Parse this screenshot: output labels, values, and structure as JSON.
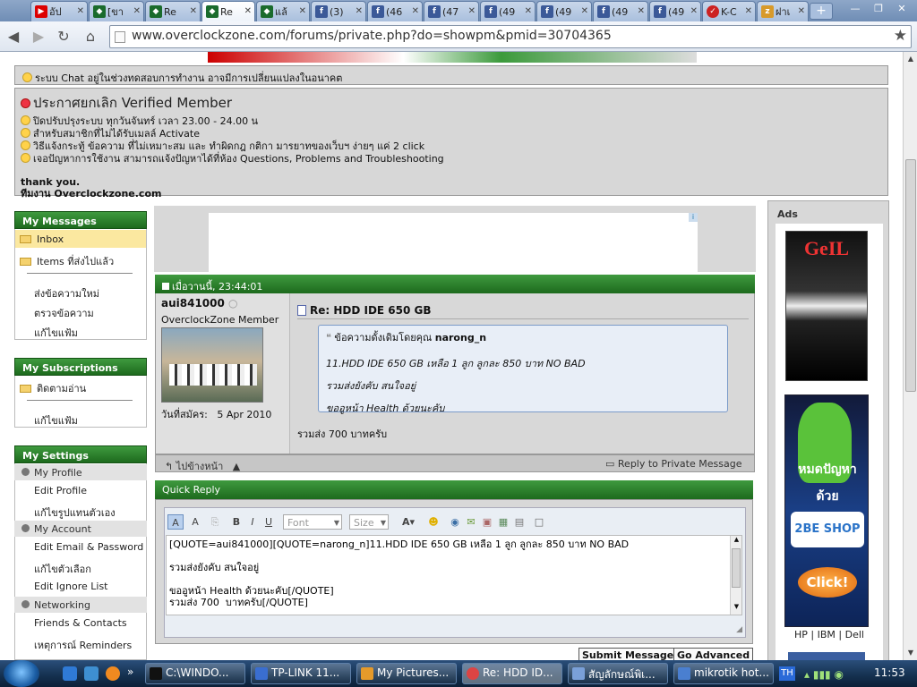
{
  "browser": {
    "tabs": [
      {
        "label": "อัป",
        "icon": "youtube-icon"
      },
      {
        "label": "[ขา",
        "icon": "overclockzone-icon"
      },
      {
        "label": "Re",
        "icon": "overclockzone-icon"
      },
      {
        "label": "Re",
        "icon": "overclockzone-icon",
        "active": true
      },
      {
        "label": "แล้",
        "icon": "overclockzone-icon"
      },
      {
        "label": "(3)",
        "icon": "facebook-icon"
      },
      {
        "label": "(46",
        "icon": "facebook-icon"
      },
      {
        "label": "(47",
        "icon": "facebook-icon"
      },
      {
        "label": "(49",
        "icon": "facebook-icon"
      },
      {
        "label": "(49",
        "icon": "facebook-icon"
      },
      {
        "label": "(49",
        "icon": "facebook-icon"
      },
      {
        "label": "(49",
        "icon": "facebook-icon"
      },
      {
        "label": "K-C",
        "icon": "kcenter-icon"
      },
      {
        "label": "ฝาเ",
        "icon": "pdf-icon"
      }
    ],
    "url": "www.overclockzone.com/forums/private.php?do=showpm&pmid=30704365"
  },
  "notice": {
    "chat": "ระบบ Chat อยู่ในช่วงทดสอบการทำงาน อาจมีการเปลี่ยนแปลงในอนาคต",
    "title": "ประกาศยกเลิก Verified Member",
    "lines": [
      "ปิดปรับปรุงระบบ ทุกวันจันทร์ เวลา 23.00 - 24.00 น",
      "สำหรับสมาชิกที่ไม่ได้รับเมลล์ Activate",
      "วิธีแจ้งกระทู้ ข้อความ ที่ไม่เหมาะสม และ ทำผิดกฎ กติกา มารยาทของเว็บฯ ง่ายๆ แค่ 2 click",
      "เจอปัญหาการใช้งาน สามารถแจ้งปัญหาได้ที่ห้อง Questions, Problems and Troubleshooting"
    ],
    "thanks": "thank you.",
    "team": "ทีมงาน Overclockzone.com"
  },
  "sidebar": {
    "messages": {
      "title": "My Messages",
      "inbox": "Inbox",
      "sent": "Items ที่ส่งไปแล้ว",
      "send_new": "ส่งข้อความใหม่",
      "track": "ตรวจข้อความ",
      "edit": "แก้ไขแฟ้ม"
    },
    "subscriptions": {
      "title": "My Subscriptions",
      "followed": "ติดตามอ่าน",
      "edit": "แก้ไขแฟ้ม"
    },
    "settings": {
      "title": "My Settings",
      "my_profile": "My Profile",
      "edit_profile": "Edit Profile",
      "edit_avatar": "แก้ไขรูปแทนตัวเอง",
      "my_account": "My Account",
      "edit_email": "Edit Email & Password",
      "edit_options": "แก้ไขตัวเลือก",
      "ignore_list": "Edit Ignore List",
      "networking": "Networking",
      "friends": "Friends & Contacts",
      "reminders": "เหตุการณ์ Reminders"
    }
  },
  "post": {
    "date": "เมื่อวานนี้, 23:44:01",
    "username": "aui841000",
    "user_title": "OverclockZone Member",
    "join_label": "วันที่สมัคร:",
    "join_date": "5 Apr 2010",
    "subject": "Re: HDD IDE 650 GB",
    "quote_label": "ข้อความดั้งเดิมโดยคุณ",
    "quote_author": "narong_n",
    "quote_lines": [
      "11.HDD IDE 650 GB เหลือ 1 ลูก ลูกละ 850 บาท NO BAD",
      "รวมส่งยังคับ สนใจอยู่",
      "ขออูหน้า Health ด้วยนะคับ"
    ],
    "body": "รวมส่ง 700 บาทครับ",
    "back": "ไปข้างหน้า",
    "reply": "Reply to Private Message"
  },
  "quick_reply": {
    "title": "Quick Reply",
    "font_label": "Font",
    "size_label": "Size",
    "text": "[QUOTE=aui841000][QUOTE=narong_n]11.HDD IDE 650 GB เหลือ 1 ลูก ลูกละ 850 บาท NO BAD\n\nรวมส่งยังคับ สนใจอยู่\n\nขออูหน้า Health ด้วยนะคับ[/QUOTE]\nรวมส่ง 700  บาทครับ[/QUOTE]",
    "submit": "Submit Message",
    "advanced": "Go Advanced"
  },
  "ads": {
    "title": "Ads",
    "geil_logo": "GeIL",
    "shop_text1": "หมดปัญหา",
    "shop_text2": "ด้วย",
    "shop_logo": "2BE SHOP",
    "shop_click": "Click!",
    "brands": "HP | IBM | Dell"
  },
  "taskbar": {
    "items": [
      "C:\\WINDO...",
      "TP-LINK 11...",
      "My Pictures...",
      "Re: HDD ID...",
      "สัญลักษณ์พิเ...",
      "mikrotik hot..."
    ],
    "lang": "TH",
    "clock": "11:53"
  }
}
